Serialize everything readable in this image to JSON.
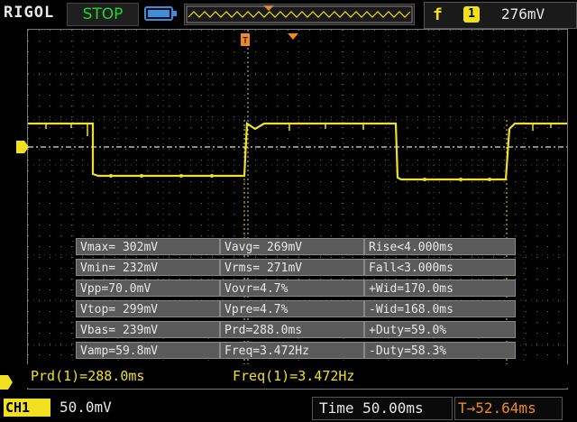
{
  "header": {
    "brand": "RIGOL",
    "run_state": "STOP",
    "trigger_edge_symbol": "f",
    "trigger_channel": "1",
    "trigger_level": "276mV"
  },
  "measurements": {
    "rows": [
      [
        "Vmax= 302mV",
        "Vavg= 269mV",
        "Rise<4.000ms"
      ],
      [
        "Vmin= 232mV",
        "Vrms= 271mV",
        "Fall<3.000ms"
      ],
      [
        "Vpp=70.0mV",
        "Vovr=4.7%",
        "+Wid=170.0ms"
      ],
      [
        "Vtop= 299mV",
        "Vpre=4.7%",
        "-Wid=168.0ms"
      ],
      [
        "Vbas= 239mV",
        "Prd=288.0ms",
        "+Duty=59.0%"
      ],
      [
        "Vamp=59.8mV",
        "Freq=3.472Hz",
        "-Duty=58.3%"
      ]
    ]
  },
  "status": {
    "period": "Prd(1)=288.0ms",
    "frequency": "Freq(1)=3.472Hz"
  },
  "footer": {
    "channel_label": "CH1",
    "channel_scale": "50.0mV",
    "time_scale": "Time 50.00ms",
    "trigger_position": "T→52.64ms"
  },
  "colors": {
    "trace": "#f0e020",
    "run_state": "#22d431",
    "trigger_marker": "#f08a20",
    "battery": "#3a8ede"
  }
}
